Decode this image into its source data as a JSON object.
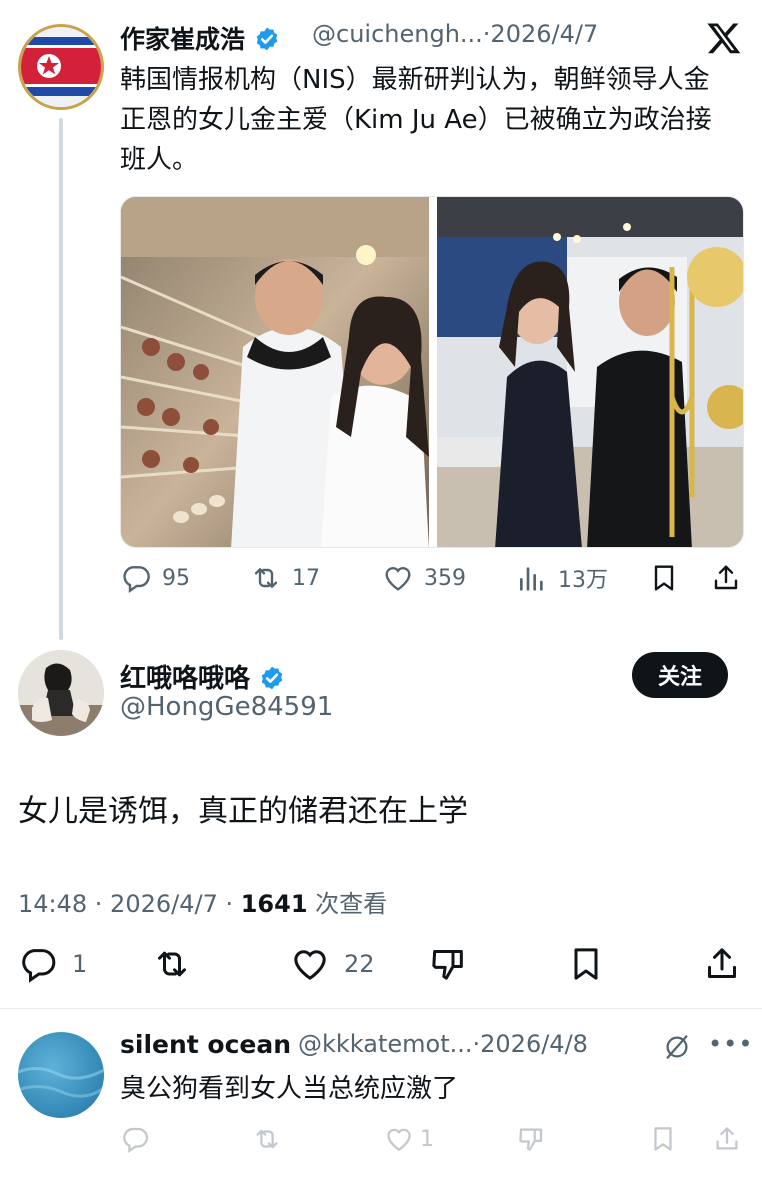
{
  "quoted_tweet": {
    "author_name": "作家崔成浩",
    "handle": "@cuichengh...",
    "date": "·2026/4/7",
    "text": "韩国情报机构（NIS）最新研判认为，朝鲜领导人金正恩的女儿金主爱（Kim Ju Ae）已被确立为政治接班人。",
    "actions": {
      "replies": "95",
      "reposts": "17",
      "likes": "359",
      "views": "13万"
    }
  },
  "reply_tweet": {
    "author_name": "红哦咯哦咯",
    "handle": "@HongGe84591",
    "follow_label": "关注",
    "text": "女儿是诱饵，真正的储君还在上学",
    "meta_time": "14:48 · 2026/4/7 · ",
    "meta_views_count": "1641",
    "meta_views_label": " 次查看",
    "actions": {
      "replies": "1",
      "likes": "22"
    }
  },
  "third_tweet": {
    "author_name": "silent ocean",
    "handle": "@kkkatemot...",
    "date": "·2026/4/8",
    "text": "臭公狗看到女人当总统应激了",
    "actions": {
      "likes": "1"
    }
  },
  "colors": {
    "verified_blue": "#1d9bf0",
    "text_primary": "#0f1419",
    "text_secondary": "#536471"
  },
  "icons": [
    "verified-icon",
    "x-logo-icon",
    "reply-icon",
    "repost-icon",
    "like-icon",
    "views-icon",
    "bookmark-icon",
    "share-icon",
    "dislike-icon",
    "grok-icon",
    "more-icon"
  ]
}
